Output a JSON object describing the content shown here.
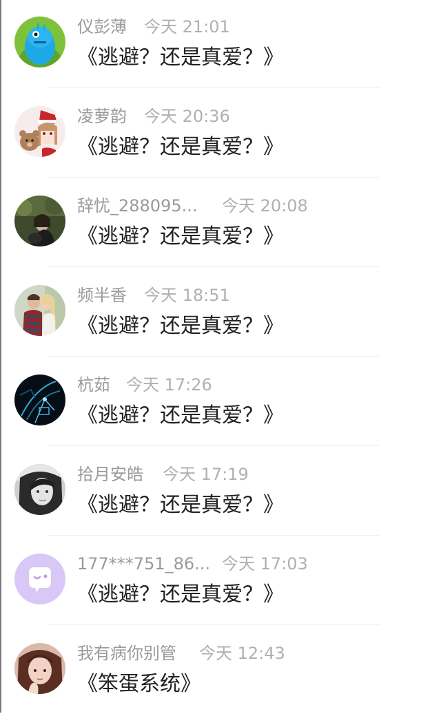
{
  "messages": [
    {
      "name": "仪彭薄",
      "time": "今天 21:01",
      "text": "《逃避？还是真爱？》",
      "avatar": "blue-monster-toy-avatar"
    },
    {
      "name": "凌萝韵",
      "time": "今天 20:36",
      "text": "《逃避？还是真爱？》",
      "avatar": "christmas-girl-with-teddy-bear-avatar"
    },
    {
      "name": "辞忧_288095...",
      "time": "今天 20:08",
      "text": "《逃避？还是真爱？》",
      "avatar": "forest-couple-photo-avatar"
    },
    {
      "name": "频半香",
      "time": "今天 18:51",
      "text": "《逃避？还是真爱？》",
      "avatar": "couple-kissing-photo-avatar"
    },
    {
      "name": "杭茹",
      "time": "今天 17:26",
      "text": "《逃避？还是真爱？》",
      "avatar": "dark-neon-abstract-avatar"
    },
    {
      "name": "拾月安皓",
      "time": "今天 17:19",
      "text": "《逃避？还是真爱？》",
      "avatar": "grayscale-girl-portrait-avatar"
    },
    {
      "name": "177***751_86...",
      "time": "今天 17:03",
      "text": "《逃避？还是真爱？》",
      "avatar": "default-purple-chat-avatar"
    },
    {
      "name": "我有病你别管",
      "time": "今天 12:43",
      "text": "《笨蛋系统》",
      "avatar": "girl-hand-on-face-avatar"
    }
  ],
  "colors": {
    "name": "#9a9a9a",
    "time": "#b0b0b0",
    "message": "#222222",
    "divider": "#eeeeee",
    "default_avatar": "#d9c8f5"
  }
}
